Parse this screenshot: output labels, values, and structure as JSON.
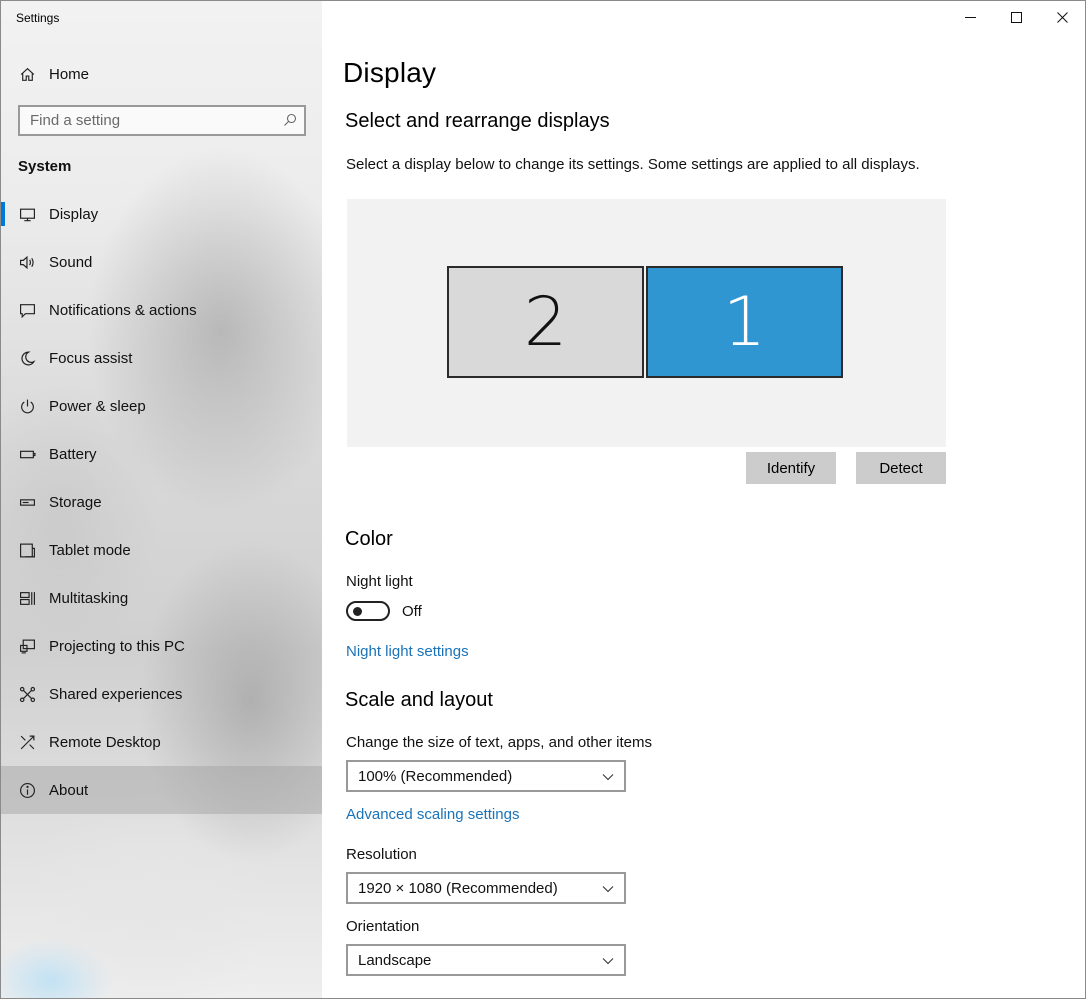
{
  "window": {
    "app_title": "Settings"
  },
  "sidebar": {
    "home_label": "Home",
    "search_placeholder": "Find a setting",
    "section_label": "System",
    "items": [
      {
        "label": "Display"
      },
      {
        "label": "Sound"
      },
      {
        "label": "Notifications & actions"
      },
      {
        "label": "Focus assist"
      },
      {
        "label": "Power & sleep"
      },
      {
        "label": "Battery"
      },
      {
        "label": "Storage"
      },
      {
        "label": "Tablet mode"
      },
      {
        "label": "Multitasking"
      },
      {
        "label": "Projecting to this PC"
      },
      {
        "label": "Shared experiences"
      },
      {
        "label": "Remote Desktop"
      },
      {
        "label": "About"
      }
    ],
    "active_item": "Display",
    "hovered_item": "About"
  },
  "main": {
    "title": "Display",
    "arrange": {
      "heading": "Select and rearrange displays",
      "description": "Select a display below to change its settings. Some settings are applied to all displays.",
      "monitors": [
        {
          "number": "2",
          "selected": false
        },
        {
          "number": "1",
          "selected": true
        }
      ],
      "identify_label": "Identify",
      "detect_label": "Detect"
    },
    "color": {
      "heading": "Color",
      "night_light_label": "Night light",
      "night_light_state": "Off",
      "night_light_settings_link": "Night light settings"
    },
    "scale": {
      "heading": "Scale and layout",
      "size_label": "Change the size of text, apps, and other items",
      "size_value": "100% (Recommended)",
      "advanced_link": "Advanced scaling settings",
      "resolution_label": "Resolution",
      "resolution_value": "1920 × 1080 (Recommended)",
      "orientation_label": "Orientation",
      "orientation_value": "Landscape"
    }
  },
  "colors": {
    "accent": "#0078d7",
    "selected_monitor": "#2f96d1",
    "link": "#1a73b8"
  }
}
